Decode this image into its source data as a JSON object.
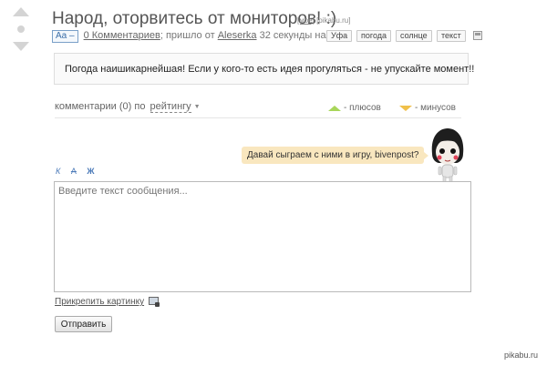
{
  "post": {
    "title": "Народ, оторвитесь от мониторов! :)",
    "source_my": "[моё]",
    "source_site": "[pikabu.ru]",
    "font_toggle": "Aa –",
    "comments_link": "0 Комментариев",
    "from_text": "; пришло от",
    "author": "Aleserka",
    "time_ago": "32 секунды назад",
    "tags": [
      "Уфа",
      "погода",
      "солнце",
      "текст"
    ]
  },
  "message": "Погода наишикарнейшая! Если у кого-то есть идея прогуляться - не упускайте момент!!",
  "comments_bar": {
    "count_text": "комментарии (0) по",
    "sort_value": "рейтингу",
    "plus_label": "- плюсов",
    "minus_label": "- минусов"
  },
  "mascot_bubble": "Давай сыграем с ними в игру, bivenpost?",
  "editor": {
    "format_italic": "К",
    "format_strike": "А",
    "format_bold": "Ж",
    "placeholder": "Введите текст сообщения...",
    "attach_label": "Прикрепить картинку",
    "send_label": "Отправить"
  },
  "watermark": "pikabu.ru",
  "colors": {
    "plus": "#a8d65a",
    "minus": "#f0c04a",
    "bubble": "#f9e7bf",
    "link_blue": "#4a79b8"
  }
}
